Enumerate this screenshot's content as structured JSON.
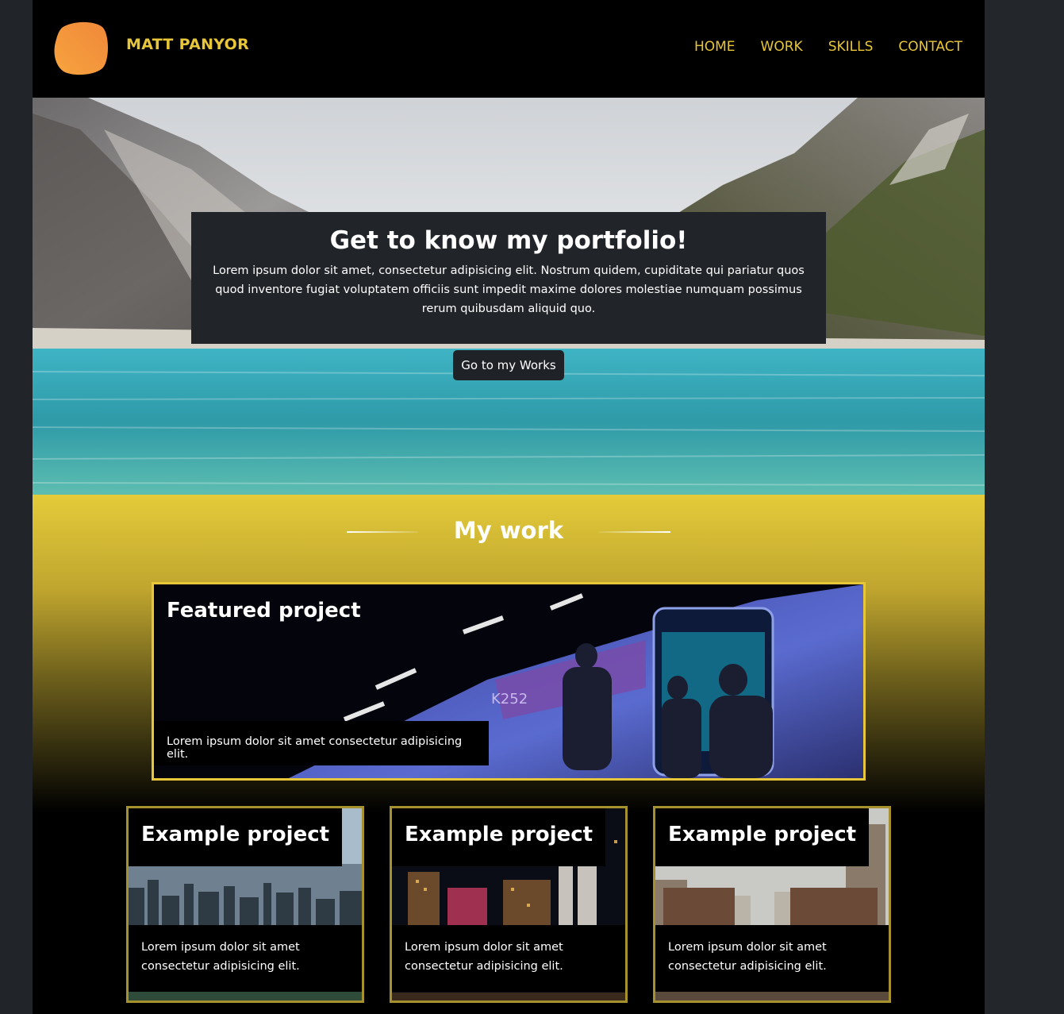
{
  "header": {
    "brand": "MATT PANYOR",
    "nav": [
      "HOME",
      "WORK",
      "SKILLS",
      "CONTACT"
    ],
    "accent_color": "#e8c63a",
    "logo_color": "#f39a3c"
  },
  "hero": {
    "title": "Get to know my portfolio!",
    "text": "Lorem ipsum dolor sit amet, consectetur adipisicing elit. Nostrum quidem, cupiditate qui pariatur quos quod inventore fugiat voluptatem officiis sunt impedit maxime dolores molestiae numquam possimus rerum quibusdam aliquid quo.",
    "button": "Go to my Works"
  },
  "work": {
    "title": "My work",
    "featured": {
      "title": "Featured project",
      "description": "Lorem ipsum dolor sit amet consectetur adipisicing elit.",
      "train_label": "K252"
    },
    "projects": [
      {
        "title": "Example project",
        "description": "Lorem ipsum dolor sit amet consectetur adipisicing elit."
      },
      {
        "title": "Example project",
        "description": "Lorem ipsum dolor sit amet consectetur adipisicing elit."
      },
      {
        "title": "Example project",
        "description": "Lorem ipsum dolor sit amet consectetur adipisicing elit."
      }
    ]
  }
}
